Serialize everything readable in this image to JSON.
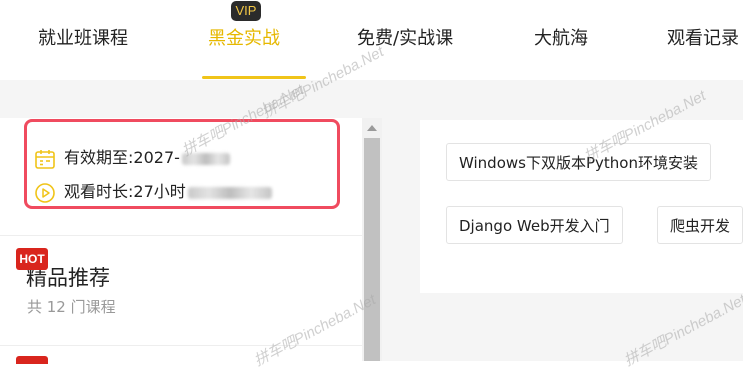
{
  "nav": {
    "tabs": [
      {
        "label": "就业班课程"
      },
      {
        "label": "黑金实战",
        "badge": "VIP",
        "active": true
      },
      {
        "label": "免费/实战课"
      },
      {
        "label": "大航海"
      },
      {
        "label": "观看记录"
      }
    ]
  },
  "membership": {
    "validity_label": "有效期至:",
    "validity_value": "2027-",
    "watch_label": "观看时长:",
    "watch_value": "27小时"
  },
  "recommend": {
    "badge": "HOT",
    "title": "精品推荐",
    "count": "共 12 门课程"
  },
  "chips": [
    {
      "label": "Windows下双版本Python环境安装"
    },
    {
      "label": "Django Web开发入门"
    },
    {
      "label": "爬虫开发"
    }
  ],
  "watermark": "拼车吧Pincheba.Net",
  "colors": {
    "accent": "#e6b800",
    "highlight_border": "#f04b5f",
    "hot": "#d9251d",
    "vip_bg": "#2b2b2b",
    "vip_text": "#f3c846"
  },
  "icons": {
    "validity": "calendar-icon",
    "watch": "play-circle-icon"
  }
}
